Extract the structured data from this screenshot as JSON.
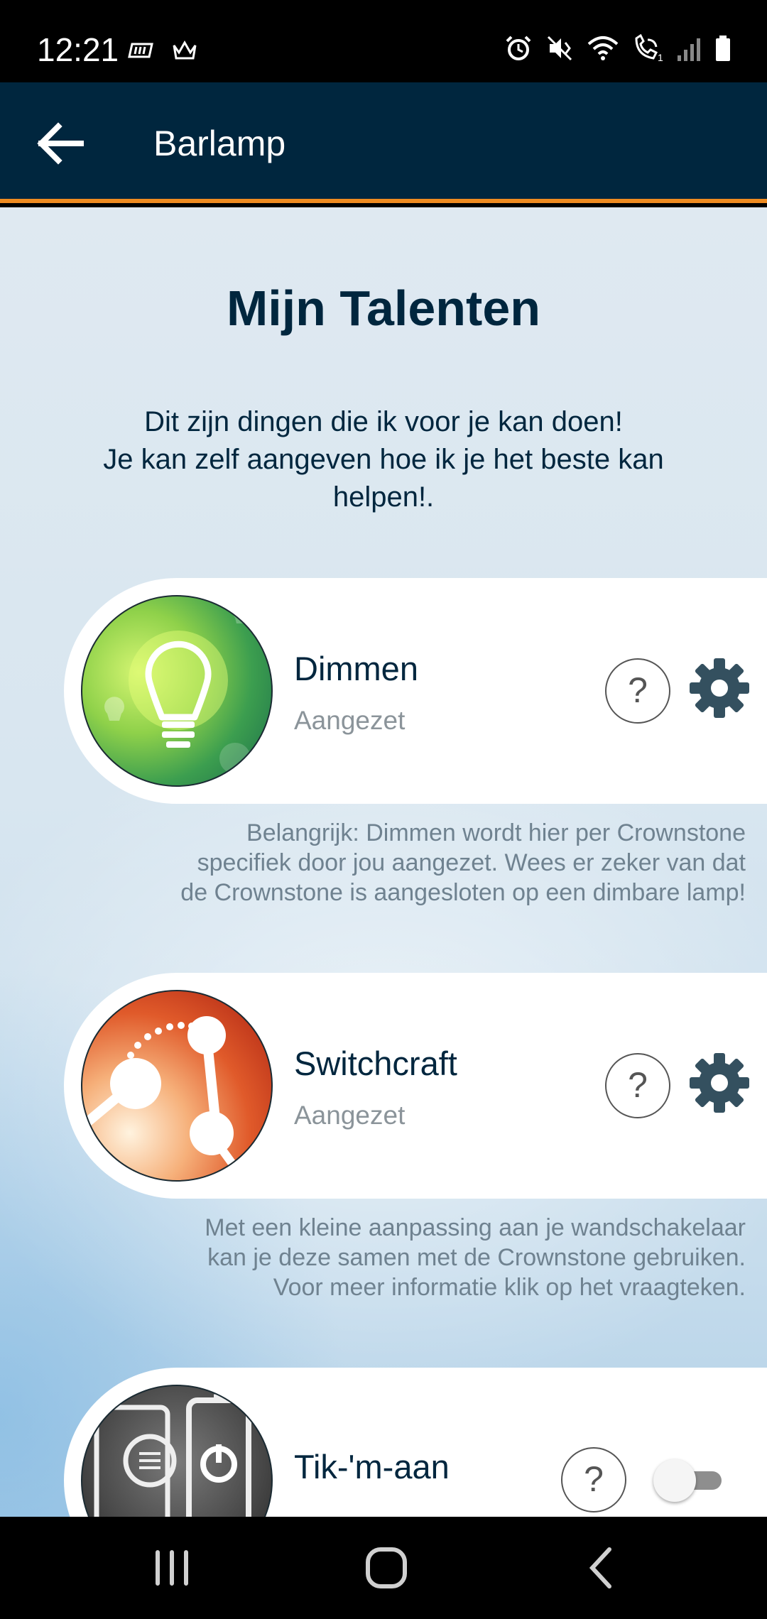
{
  "status_bar": {
    "time": "12:21",
    "left_icons": [
      "app-notification-icon",
      "crown-notification-icon"
    ],
    "right_icons": [
      "alarm-icon",
      "mute-icon",
      "wifi-icon",
      "wifi-call-icon",
      "signal-icon",
      "battery-icon"
    ],
    "wifi_call_sub": "1"
  },
  "app_bar": {
    "title": "Barlamp",
    "back_icon": "arrow-left-icon",
    "bg_color": "#00263e",
    "accent_color": "#ee8b21"
  },
  "page": {
    "title": "Mijn Talenten",
    "intro_lines": [
      "Dit zijn dingen die ik voor je kan doen!",
      "Je kan zelf aangeven hoe ik je het beste kan",
      "helpen!."
    ]
  },
  "talents": [
    {
      "name": "Dimmen",
      "status": "Aangezet",
      "icon": "light-bulb-icon",
      "help_label": "?",
      "control": "settings",
      "description_lines": [
        "Belangrijk: Dimmen wordt hier per Crownstone",
        "specifiek door jou aangezet. Wees er zeker van dat",
        "de Crownstone is aangesloten op een dimbare lamp!"
      ]
    },
    {
      "name": "Switchcraft",
      "status": "Aangezet",
      "icon": "switch-icon",
      "help_label": "?",
      "control": "settings",
      "description_lines": [
        "Met een kleine aanpassing aan je wandschakelaar",
        "kan je deze samen met de Crownstone gebruiken.",
        "Voor meer informatie klik op het vraagteken."
      ]
    },
    {
      "name": "Tik-'m-aan",
      "icon": "socket-phone-icon",
      "help_label": "?",
      "control": "toggle",
      "toggle_on": false
    }
  ],
  "nav_bar": {
    "icons": [
      "recent-apps-icon",
      "home-icon",
      "back-icon"
    ]
  }
}
